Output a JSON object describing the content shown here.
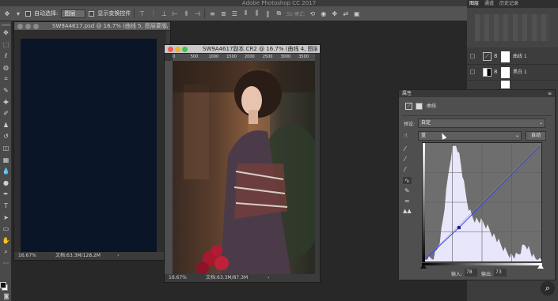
{
  "app": {
    "title": "Adobe Photoshop CC 2017"
  },
  "options_bar": {
    "auto_select_label": "自动选择:",
    "auto_select_value": "图层",
    "show_transform_label": "显示变换控件",
    "mode_3d_label": "3D 模式:"
  },
  "toolbar": {
    "tools": [
      {
        "name": "move-tool",
        "glyph": "✥"
      },
      {
        "name": "marquee-tool",
        "glyph": "⬚"
      },
      {
        "name": "lasso-tool",
        "glyph": "ℓ"
      },
      {
        "name": "quick-select-tool",
        "glyph": "◍"
      },
      {
        "name": "crop-tool",
        "glyph": "⌗"
      },
      {
        "name": "eyedropper-tool",
        "glyph": "✎"
      },
      {
        "name": "healing-tool",
        "glyph": "✚"
      },
      {
        "name": "brush-tool",
        "glyph": "✐"
      },
      {
        "name": "clone-stamp-tool",
        "glyph": "♟"
      },
      {
        "name": "history-brush-tool",
        "glyph": "↺"
      },
      {
        "name": "eraser-tool",
        "glyph": "◫"
      },
      {
        "name": "gradient-tool",
        "glyph": "▦"
      },
      {
        "name": "blur-tool",
        "glyph": "💧"
      },
      {
        "name": "dodge-tool",
        "glyph": "●"
      },
      {
        "name": "pen-tool",
        "glyph": "✒"
      },
      {
        "name": "type-tool",
        "glyph": "T"
      },
      {
        "name": "path-select-tool",
        "glyph": "➤"
      },
      {
        "name": "shape-tool",
        "glyph": "▭"
      },
      {
        "name": "hand-tool",
        "glyph": "✋"
      },
      {
        "name": "zoom-tool",
        "glyph": "⌕"
      },
      {
        "name": "more-tools",
        "glyph": "···"
      }
    ]
  },
  "doc1": {
    "title": "SW9A4617.psd @ 16.7% (曲线 5, 图层蒙版/...",
    "zoom": "16.67%",
    "doc_size": "文档:63.3M/128.2M",
    "arrow": "›"
  },
  "doc2": {
    "title": "SW9A4617副本.CR2 @ 16.7% (曲线 4, 图层...",
    "zoom": "16.67%",
    "doc_size": "文档:63.3M/87.3M",
    "arrow": "›",
    "ruler": [
      "0",
      "500",
      "1000",
      "1500",
      "2000",
      "2500",
      "3000",
      "3500"
    ]
  },
  "layers_panel": {
    "tabs": [
      "图层",
      "通道",
      "历史记录"
    ],
    "layers": [
      {
        "name": "曲线 1"
      },
      {
        "name": "黑白 1"
      }
    ]
  },
  "properties": {
    "panel_title": "属性",
    "adj_name": "曲线",
    "preset_label": "预设:",
    "preset_value": "自定",
    "channel_value": "蓝",
    "auto_button": "自动",
    "input_label": "输入:",
    "input_value": "78",
    "output_label": "输出:",
    "output_value": "73",
    "curve_color": "#3a44ff",
    "histogram_color": "#e8e6fb"
  }
}
